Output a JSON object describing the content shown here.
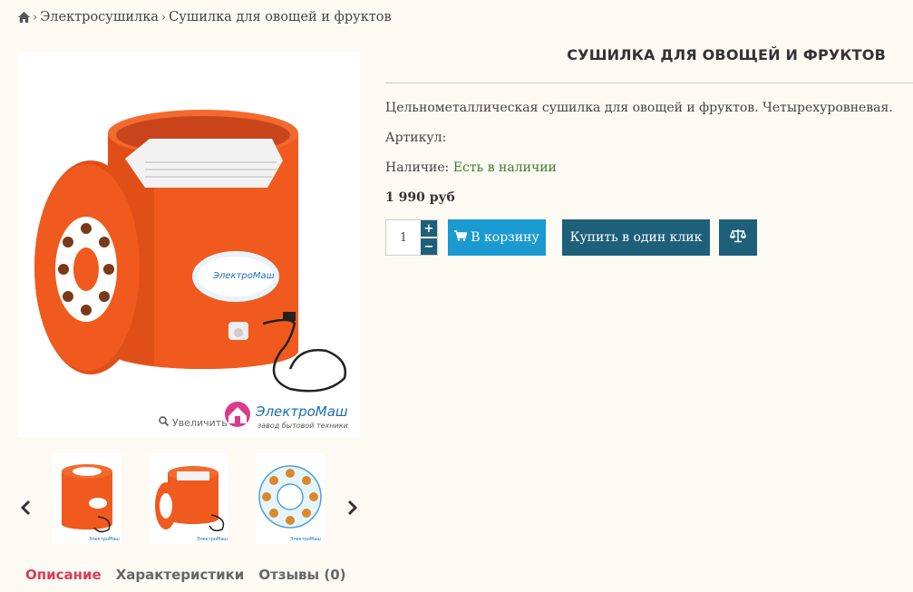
{
  "breadcrumb": {
    "home_icon": "home-icon",
    "items": [
      "Электросушилка",
      "Сушилка для овощей и фруктов"
    ]
  },
  "product": {
    "title": "СУШИЛКА ДЛЯ ОВОЩЕЙ И ФРУКТОВ",
    "description": "Цельнометаллическая сушилка для овощей и фруктов. Четырехуровневая.",
    "article_label": "Артикул:",
    "availability_label": "Наличие:",
    "availability_value": "Есть в наличии",
    "price": "1 990 руб"
  },
  "gallery": {
    "zoom_label": "Увеличить",
    "logo_text": "ЭлектроМаш",
    "logo_subtext": "завод бытовой техники",
    "thumbnails": [
      "dryer-closed",
      "dryer-open",
      "lid-top-view"
    ]
  },
  "purchase": {
    "quantity": "1",
    "plus": "+",
    "minus": "−",
    "cart_label": "В корзину",
    "one_click_label": "Купить в один клик",
    "compare_icon": "scales-icon"
  },
  "tabs": [
    {
      "label": "Описание",
      "active": true
    },
    {
      "label": "Характеристики",
      "active": false
    },
    {
      "label": "Отзывы (0)",
      "active": false
    }
  ],
  "colors": {
    "accent": "#1e5f7a",
    "cart": "#1b9ad1",
    "active_tab": "#d83c5c",
    "in_stock": "#3c7a30",
    "product_orange": "#f05a1e"
  }
}
